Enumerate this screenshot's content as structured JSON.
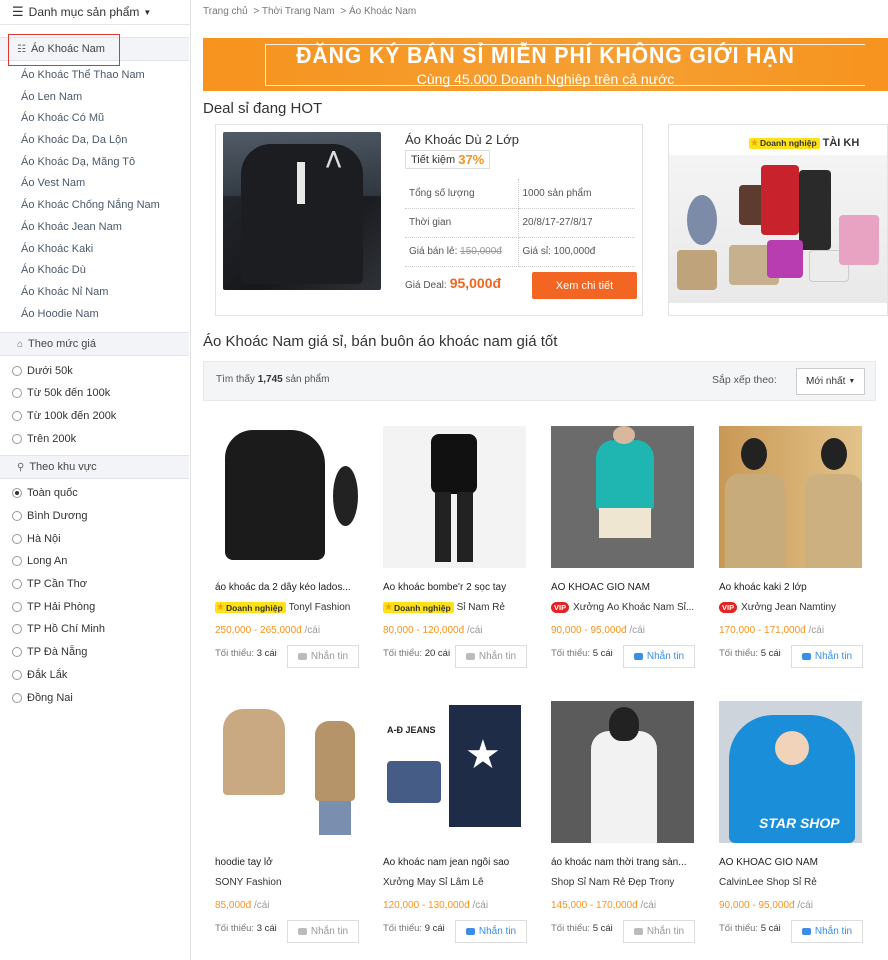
{
  "sidebar": {
    "menu_label": "Danh mục sản phẩm",
    "active_category": "Áo Khoác Nam",
    "subcategories": [
      "Áo Khoác Thể Thao Nam",
      "Áo Len Nam",
      "Áo Khoác Có Mũ",
      "Áo Khoác Da, Da Lộn",
      "Áo Khoác Dạ, Măng Tô",
      "Áo Vest Nam",
      "Áo Khoác Chống Nắng Nam",
      "Áo Khoác Jean Nam",
      "Áo Khoác Kaki",
      "Áo Khoác Dù",
      "Áo Khoác Nỉ Nam",
      "Áo Hoodie Nam"
    ],
    "price_filter_title": "Theo mức giá",
    "price_options": [
      "Dưới 50k",
      "Từ 50k đến 100k",
      "Từ 100k đến 200k",
      "Trên 200k"
    ],
    "region_filter_title": "Theo khu vực",
    "region_options": [
      "Toàn quốc",
      "Bình Dương",
      "Hà Nội",
      "Long An",
      "TP Cần Thơ",
      "TP Hải Phòng",
      "TP Hồ Chí Minh",
      "TP Đà Nẵng",
      "Đắk Lắk",
      "Đồng Nai"
    ],
    "region_selected": "Toàn quốc"
  },
  "breadcrumb": [
    "Trang chủ",
    "> Thời Trang Nam",
    "> Áo Khoác Nam"
  ],
  "banner": {
    "line1": "ĐĂNG KÝ BÁN SỈ MIỄN PHÍ KHÔNG GIỚI HẠN",
    "line2": "Cùng 45.000 Doanh Nghiệp trên cả nước"
  },
  "deal": {
    "section_title": "Deal sỉ đang HOT",
    "title": "Áo Khoác Dù 2 Lớp",
    "save_label": "Tiết kiệm",
    "save_value": "37%",
    "rows": [
      {
        "label": "Tổng số lượng",
        "value": "1000 sản phẩm"
      },
      {
        "label": "Thời gian",
        "value": "20/8/17-27/8/17"
      }
    ],
    "retail_label": "Giá bán lẻ:",
    "retail_value": "150,000đ",
    "wholesale_label": "Giá sỉ:",
    "wholesale_value": "100,000đ",
    "deal_price_label": "Giá Deal:",
    "deal_price_value": "95,000đ",
    "detail_button": "Xem chi tiết"
  },
  "ad": {
    "badge": "Doanh nghiệp",
    "text": "TÀI KH"
  },
  "listing": {
    "title": "Áo Khoác Nam giá sỉ, bán buôn áo khoác nam giá tốt",
    "found_prefix": "Tìm thấy",
    "found_count": "1,745",
    "found_suffix": "sản phẩm",
    "sort_label": "Sắp xếp theo:",
    "sort_value": "Mới nhất",
    "min_label": "Tối thiểu:",
    "message_label": "Nhắn tin",
    "unit": "/cái"
  },
  "products": [
    {
      "name": "áo khoác da 2 dây kéo lados...",
      "badge": "Doanh nghiệp",
      "shop": "Tonyl Fashion",
      "price": "250,000 - 265,000đ",
      "min": "3 cái",
      "msg_active": false
    },
    {
      "name": "Áo khoác bombe'r 2 sọc tay",
      "badge": "Doanh nghiệp",
      "shop": "Sỉ Nam Rẻ",
      "price": "80,000 - 120,000đ",
      "min": "20 cái",
      "msg_active": false
    },
    {
      "name": "ÁO KHOÁC GIÓ NAM",
      "badge": "VIP",
      "shop": "Xưởng Áo Khoác Nam Sỉ...",
      "price": "90,000 - 95,000đ",
      "min": "5 cái",
      "msg_active": true
    },
    {
      "name": "Áo khoác kaki 2 lớp",
      "badge": "VIP",
      "shop": "Xưởng Jean Namtiny",
      "price": "170,000 - 171,000đ",
      "min": "5 cái",
      "msg_active": true
    },
    {
      "name": "hoodie tay lở",
      "badge": "",
      "shop": "SONY Fashion",
      "price": "85,000đ",
      "min": "3 cái",
      "msg_active": false
    },
    {
      "name": "Áo khoác nam jean ngôi sao",
      "badge": "",
      "shop": "Xưởng May Sỉ Lâm Lê",
      "price": "120,000 - 130,000đ",
      "min": "9 cái",
      "msg_active": true
    },
    {
      "name": "áo khoác nam thời trang sàn...",
      "badge": "",
      "shop": "Shop Sỉ Nam Rẻ Đẹp Trony",
      "price": "145,000 - 170,000đ",
      "min": "5 cái",
      "msg_active": false
    },
    {
      "name": "ÁO KHOÁC GIÓ NAM",
      "badge": "",
      "shop": "CalvinLee Shop Sỉ Rẻ",
      "price": "90,000 - 95,000đ",
      "min": "5 cái",
      "msg_active": true
    }
  ],
  "image_texts": {
    "p2_line1": "A-Đ JEANS",
    "p3_label": "STAR SHOP"
  }
}
